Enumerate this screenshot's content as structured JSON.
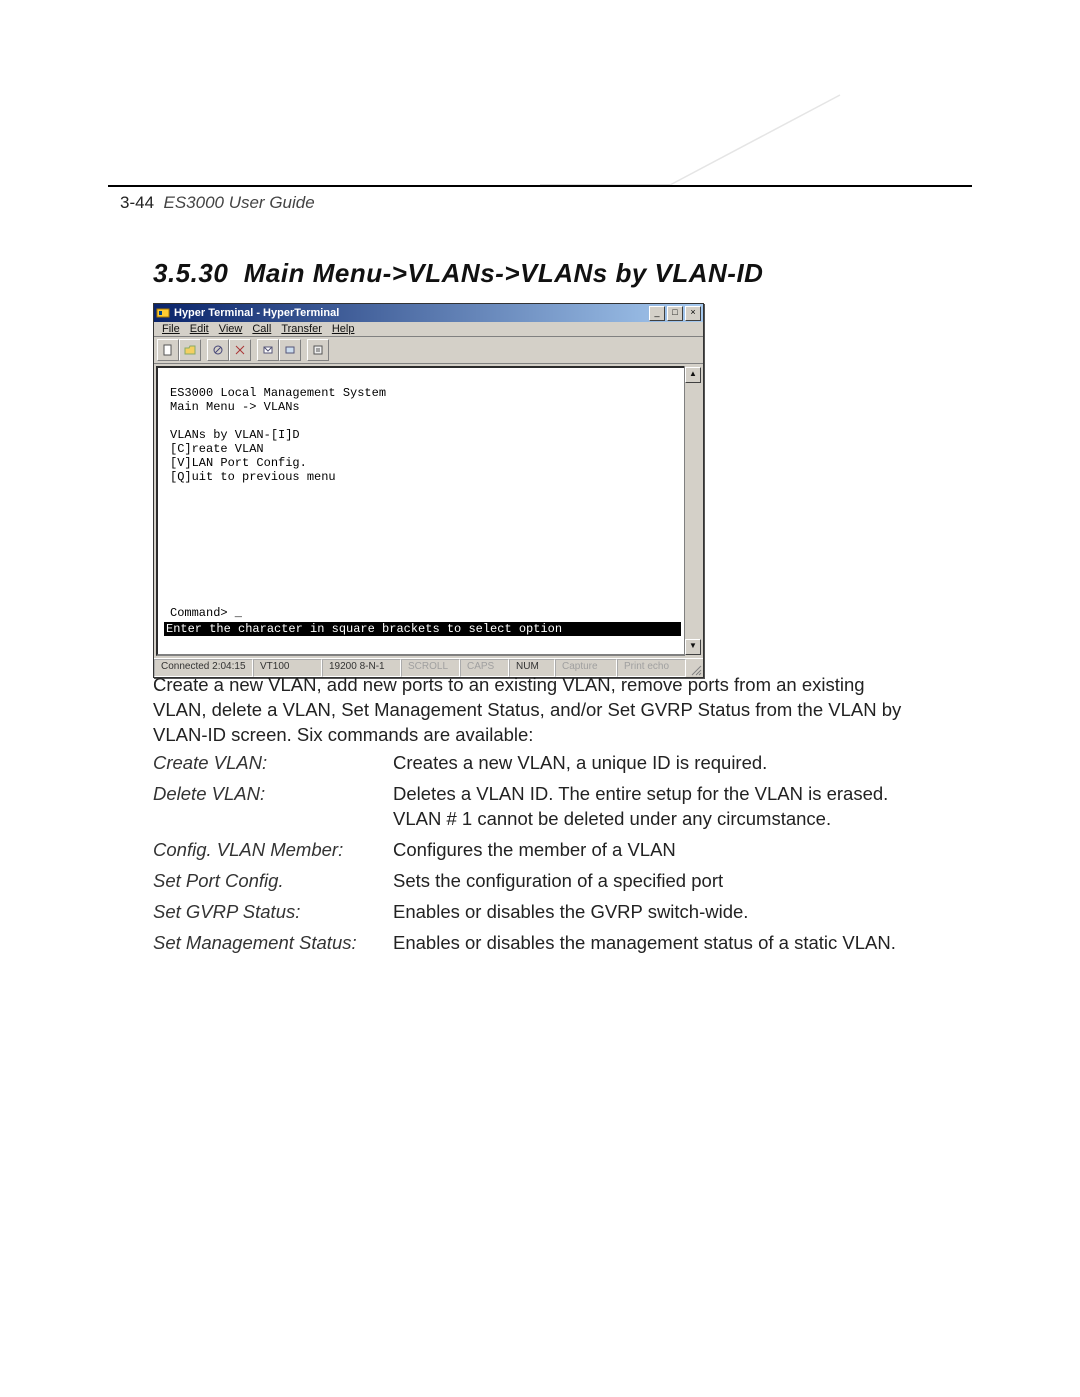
{
  "page_header": {
    "page_number": "3-44",
    "guide_title": "ES3000 User Guide"
  },
  "section": {
    "number": "3.5.30",
    "title": "Main Menu->VLANs->VLANs by VLAN-ID"
  },
  "hyperterminal": {
    "window_title": "Hyper Terminal - HyperTerminal",
    "menus": [
      "File",
      "Edit",
      "View",
      "Call",
      "Transfer",
      "Help"
    ],
    "toolbar_icons": [
      "new-doc-icon",
      "open-icon",
      "connect-icon",
      "disconnect-icon",
      "send-icon",
      "receive-icon",
      "properties-icon"
    ],
    "window_buttons": {
      "min": "_",
      "max": "□",
      "close": "×"
    },
    "scroll": {
      "up": "▲",
      "down": "▼"
    },
    "terminal_lines": [
      "ES3000 Local Management System",
      "Main Menu -> VLANs",
      "",
      "VLANs by VLAN-[I]D",
      "[C]reate VLAN",
      "[V]LAN Port Config.",
      "[Q]uit to previous menu"
    ],
    "command_prompt": "Command> _",
    "footer_inverse": "Enter the character in square brackets to select option",
    "status": {
      "connected": "Connected 2:04:15",
      "emulation": "VT100",
      "settings": "19200 8-N-1",
      "scroll": "SCROLL",
      "caps": "CAPS",
      "num": "NUM",
      "capture": "Capture",
      "printecho": "Print echo"
    }
  },
  "body_paragraph": "Create a new VLAN, add new ports to an existing VLAN, remove ports from an existing VLAN, delete a VLAN, Set Management Status, and/or Set GVRP Status from the VLAN by VLAN-ID screen. Six commands are available:",
  "commands": [
    {
      "label": "Create VLAN:",
      "desc": "Creates a new VLAN, a unique ID is required."
    },
    {
      "label": "Delete VLAN:",
      "desc": "Deletes a VLAN ID. The entire setup for the VLAN is erased. VLAN # 1 cannot be deleted under any circumstance."
    },
    {
      "label": "Config. VLAN Member:",
      "desc": "Configures the member of a VLAN"
    },
    {
      "label": "Set Port Config.",
      "desc": "Sets the configuration of a specified port"
    },
    {
      "label": "Set GVRP Status:",
      "desc": "Enables or disables the GVRP switch-wide."
    },
    {
      "label": "Set Management Status:",
      "desc": "Enables or disables the management status of a static VLAN."
    }
  ]
}
